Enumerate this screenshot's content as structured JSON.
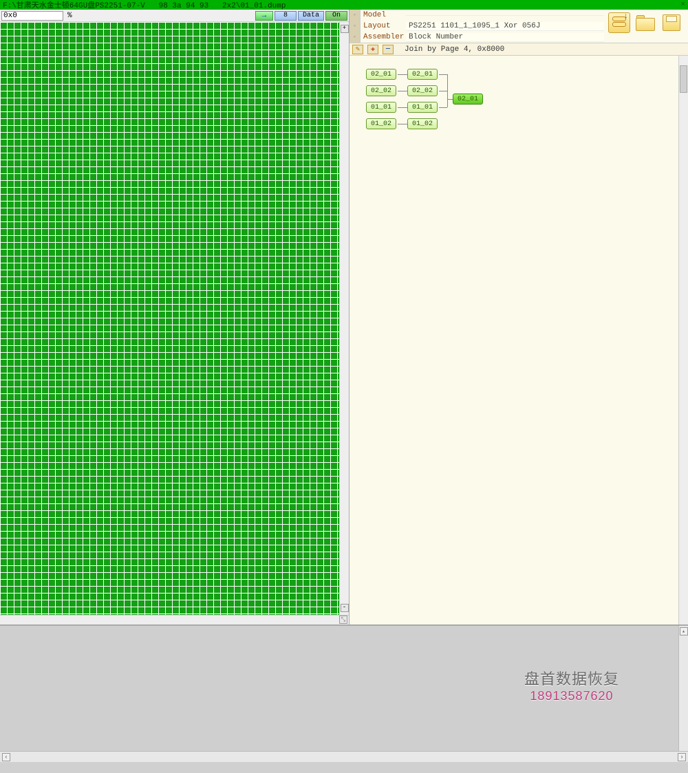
{
  "window": {
    "title": "F:\\甘肃天水金士顿64GU盘PS2251-07-V   98 3a 94 93   2x2\\01_01.dump",
    "close": "×"
  },
  "left_toolbar": {
    "offset_value": "0x0",
    "pct_label": "%",
    "arrow_label": "→",
    "num_label": "8",
    "data_label": "Data",
    "on_label": "On",
    "plus": "+",
    "minus": "-"
  },
  "props": {
    "rows": [
      {
        "label": "Model",
        "value": ""
      },
      {
        "label": "Layout",
        "value": "PS2251 1101_1_1095_1 Xor 056J"
      },
      {
        "label": "Assembler",
        "value": "Block Number"
      }
    ]
  },
  "right_toolbar": {
    "wand": "✎",
    "plus": "✚",
    "minus": "—",
    "join_text": "Join by Page 4, 0x8000"
  },
  "graph": {
    "col1": [
      "02_01",
      "02_02",
      "01_01",
      "01_02"
    ],
    "col2": [
      "02_01",
      "02_02",
      "01_01",
      "01_02"
    ],
    "merged": "02_01"
  },
  "watermark": {
    "line1": "盘首数据恢复",
    "line2": "18913587620"
  },
  "scroll": {
    "left": "‹",
    "right": "›",
    "up": "▴",
    "down": "▾",
    "handle": "⤡"
  }
}
